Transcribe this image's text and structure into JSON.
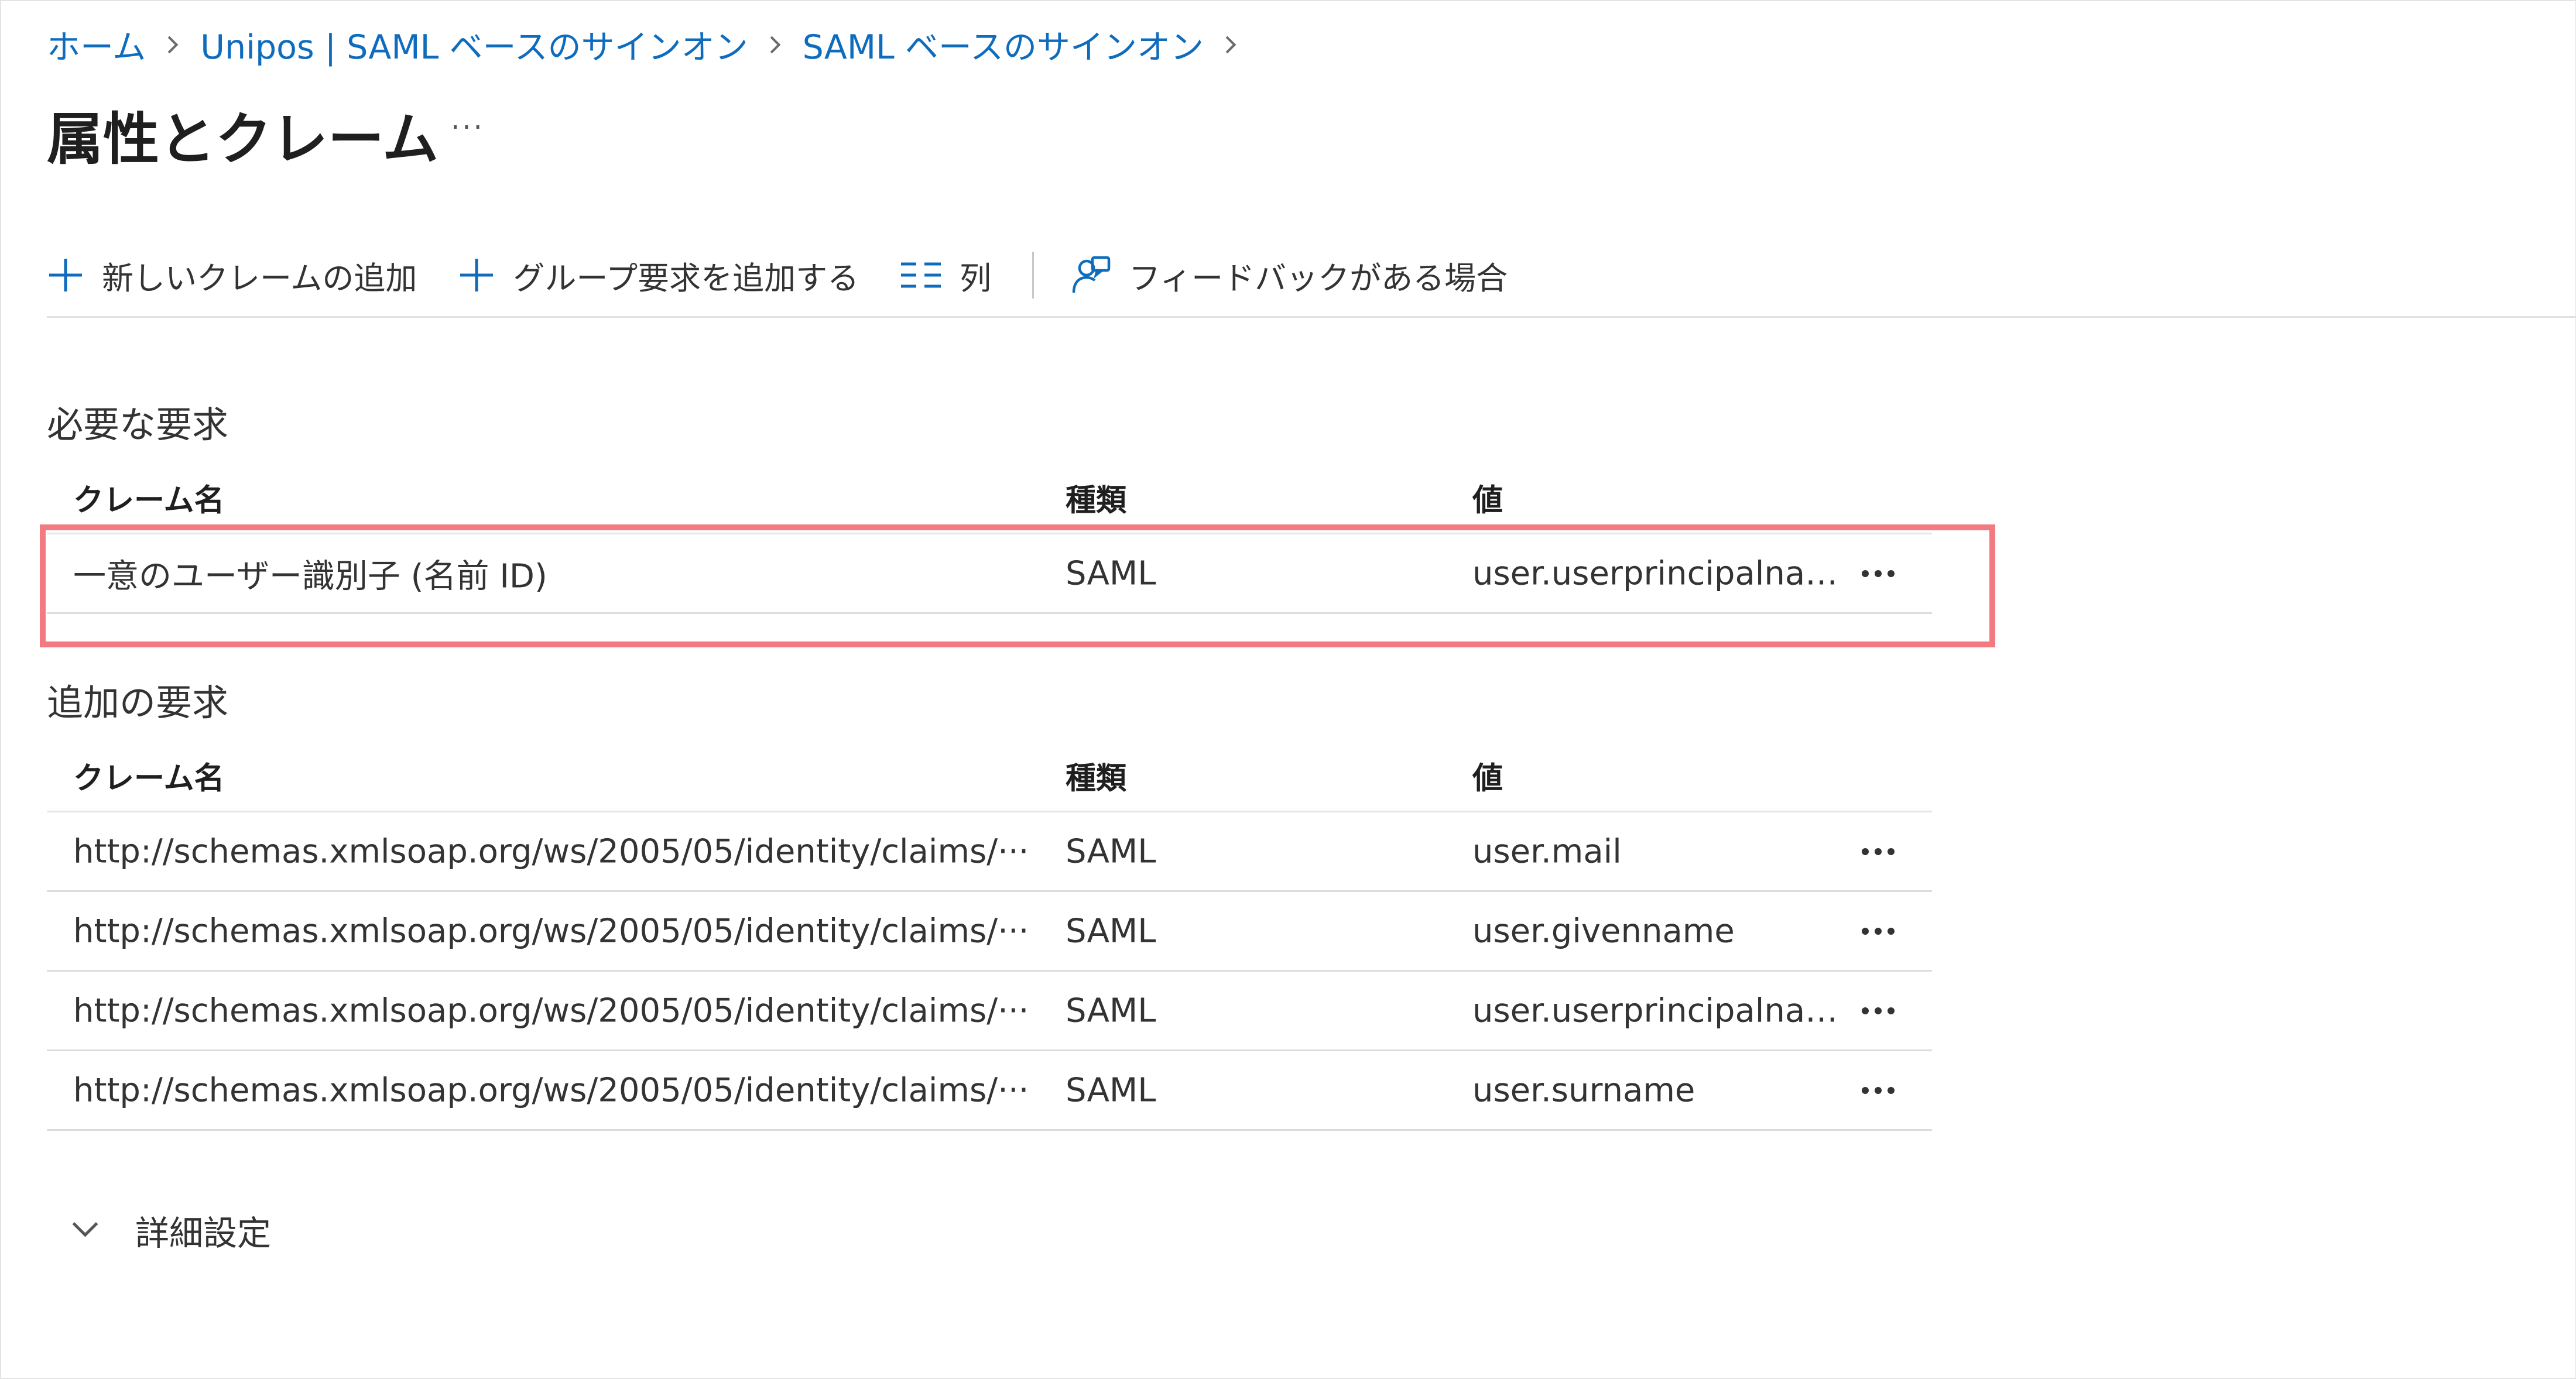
{
  "breadcrumb": {
    "items": [
      "ホーム",
      "Unipos | SAML ベースのサインオン",
      "SAML ベースのサインオン"
    ]
  },
  "page": {
    "title": "属性とクレーム",
    "more_label": "···"
  },
  "toolbar": {
    "add_claim_label": "新しいクレームの追加",
    "add_group_claim_label": "グループ要求を追加する",
    "columns_label": "列",
    "feedback_label": "フィードバックがある場合"
  },
  "required_claims": {
    "heading": "必要な要求",
    "headers": {
      "name": "クレーム名",
      "type": "種類",
      "value": "値"
    },
    "rows": [
      {
        "name": "一意のユーザー識別子 (名前 ID)",
        "type": "SAML",
        "value": "user.userprincipalnam···"
      }
    ]
  },
  "additional_claims": {
    "heading": "追加の要求",
    "headers": {
      "name": "クレーム名",
      "type": "種類",
      "value": "値"
    },
    "rows": [
      {
        "name": "http://schemas.xmlsoap.org/ws/2005/05/identity/claims/···",
        "type": "SAML",
        "value": "user.mail"
      },
      {
        "name": "http://schemas.xmlsoap.org/ws/2005/05/identity/claims/···",
        "type": "SAML",
        "value": "user.givenname"
      },
      {
        "name": "http://schemas.xmlsoap.org/ws/2005/05/identity/claims/···",
        "type": "SAML",
        "value": "user.userprincipalname"
      },
      {
        "name": "http://schemas.xmlsoap.org/ws/2005/05/identity/claims/···",
        "type": "SAML",
        "value": "user.surname"
      }
    ]
  },
  "advanced": {
    "label": "詳細設定"
  },
  "colors": {
    "link": "#0f6cbd",
    "highlight_border": "#f27a80"
  },
  "icons": {
    "add": "plus-icon",
    "columns": "columns-icon",
    "feedback": "feedback-icon",
    "more": "ellipsis-icon",
    "expand": "chevron-down-icon",
    "breadcrumb_separator": "chevron-right-icon"
  }
}
